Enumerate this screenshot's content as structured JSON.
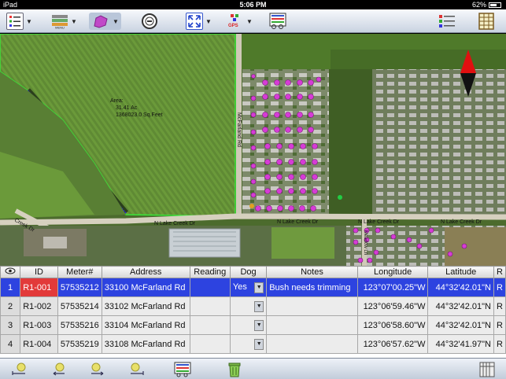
{
  "status_bar": {
    "device": "iPad",
    "time": "5:06 PM",
    "battery": "62%"
  },
  "toolbar": {
    "icons": [
      "list-icon",
      "layers-icon",
      "shape-icon",
      "compass-icon",
      "fullscreen-icon",
      "gps-icon",
      "map-settings-icon",
      "legend-icon",
      "table-icon"
    ],
    "gps_label": "GPS"
  },
  "map": {
    "area_label": "Area:",
    "area_acres": "31.41 Ac",
    "area_sqft": "1368023.0 Sq.Feet",
    "road_label_1": "N Lake Creek Dr",
    "road_label_2": "N Lake Creek Dr",
    "road_label_3": "N Lake Creek Dr",
    "road_label_4": "N Lake Creek Dr",
    "road_label_5": "McFarland Rd",
    "road_label_6": "Meadow Ln",
    "road_label_7": "Creek Dr"
  },
  "table": {
    "headers": [
      "ID",
      "Meter#",
      "Address",
      "Reading",
      "Dog",
      "Notes",
      "Longitude",
      "Latitude",
      "R"
    ],
    "rows": [
      {
        "num": "1",
        "id": "R1-001",
        "meter": "57535212",
        "address": "33100 McFarland Rd",
        "reading": "",
        "dog": "Yes",
        "notes": "Bush needs trimming",
        "lon": "123°07'00.25\"W",
        "lat": "44°32'42.01\"N",
        "r": "R"
      },
      {
        "num": "2",
        "id": "R1-002",
        "meter": "57535214",
        "address": "33102 McFarland Rd",
        "reading": "",
        "dog": "",
        "notes": "",
        "lon": "123°06'59.46\"W",
        "lat": "44°32'42.01\"N",
        "r": "R"
      },
      {
        "num": "3",
        "id": "R1-003",
        "meter": "57535216",
        "address": "33104 McFarland Rd",
        "reading": "",
        "dog": "",
        "notes": "",
        "lon": "123°06'58.60\"W",
        "lat": "44°32'42.01\"N",
        "r": "R"
      },
      {
        "num": "4",
        "id": "R1-004",
        "meter": "57535219",
        "address": "33108 McFarland Rd",
        "reading": "",
        "dog": "",
        "notes": "",
        "lon": "123°06'57.62\"W",
        "lat": "44°32'41.97\"N",
        "r": "R"
      }
    ]
  },
  "bottom_bar": {
    "icons": [
      "first-record-icon",
      "previous-record-icon",
      "next-record-icon",
      "last-record-icon",
      "map-settings-icon",
      "delete-icon",
      "table-toggle-icon"
    ]
  },
  "colors": {
    "selected_row": "#2d43e0",
    "selected_id": "#e23a3a",
    "marker": "#d63cd6",
    "boundary": "#39e639"
  }
}
